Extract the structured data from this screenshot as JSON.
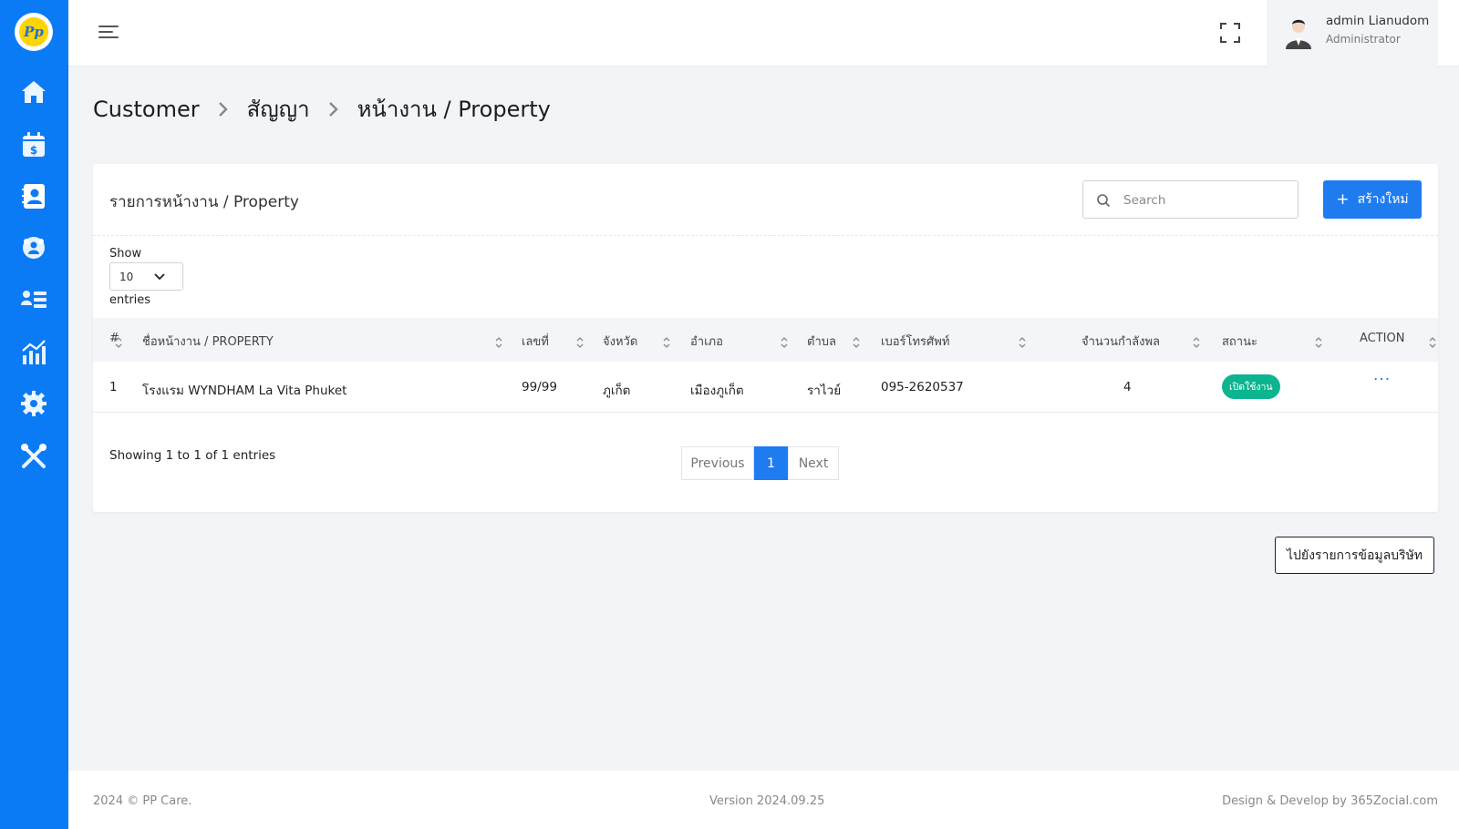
{
  "sidebar": {
    "logo_text": "Pp",
    "items": [
      {
        "icon": "home-icon"
      },
      {
        "icon": "calendar-dollar-icon"
      },
      {
        "icon": "contact-book-icon",
        "active": true
      },
      {
        "icon": "team-gear-icon"
      },
      {
        "icon": "user-list-icon"
      },
      {
        "icon": "chart-icon"
      },
      {
        "icon": "gear-icon"
      },
      {
        "icon": "tools-icon"
      }
    ]
  },
  "topbar": {
    "user_name": "admin Lianudom",
    "user_role": "Administrator"
  },
  "breadcrumb": {
    "items": [
      "Customer",
      "สัญญา",
      "หน้างาน / Property"
    ]
  },
  "card": {
    "title": "รายการหน้างาน / Property",
    "search_placeholder": "Search",
    "create_label": "สร้างใหม่",
    "create_icon": "+",
    "show_label": "Show",
    "entries_value": "10",
    "entries_label": "entries"
  },
  "table": {
    "columns": [
      "#",
      "ชื่อหน้างาน / PROPERTY",
      "เลขที่",
      "จังหวัด",
      "อำเภอ",
      "ตำบล",
      "เบอร์โทรศัพท์",
      "จำนวนกำลังพล",
      "สถานะ",
      "ACTION"
    ],
    "rows": [
      {
        "no": "1",
        "name": "โรงแรม WYNDHAM La Vita Phuket",
        "number": "99/99",
        "province": "ภูเก็ต",
        "district": "เมืองภูเก็ต",
        "subdistrict": "ราไวย์",
        "phone": "095-2620537",
        "staff": "4",
        "status": "เปิดใช้งาน",
        "action": "···"
      }
    ]
  },
  "pagination": {
    "showing_text": "Showing 1 to 1 of 1 entries",
    "previous": "Previous",
    "current": "1",
    "next": "Next"
  },
  "goto_button": "ไปยังรายการข้อมูลบริษัท",
  "footer": {
    "copyright": "2024 © PP Care.",
    "version": "Version 2024.09.25",
    "credit": "Design & Develop by 365Zocial.com"
  },
  "colors": {
    "sidebar": "#0a7bf5",
    "primary": "#1f7cf0",
    "status_active": "#0cb58f"
  }
}
